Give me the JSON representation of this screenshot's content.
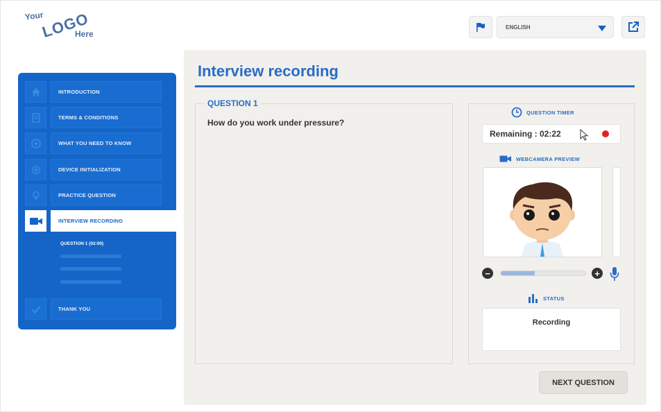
{
  "logo": {
    "line1": "Your",
    "line2": "LOGO",
    "line3": "Here"
  },
  "topbar": {
    "language": "ENGLISH",
    "icons": {
      "flag": "flag-icon",
      "popout": "external-link-icon",
      "caret": "chevron-down-icon"
    }
  },
  "sidebar": {
    "items": [
      {
        "label": "INTRODUCTION",
        "icon": "home-icon"
      },
      {
        "label": "TERMS & CONDITIONS",
        "icon": "document-icon"
      },
      {
        "label": "WHAT YOU NEED TO KNOW",
        "icon": "help-icon"
      },
      {
        "label": "DEVICE INITIALIZATION",
        "icon": "gear-icon"
      },
      {
        "label": "PRACTICE QUESTION",
        "icon": "lightbulb-icon"
      },
      {
        "label": "INTERVIEW RECORDING",
        "icon": "video-camera-icon"
      },
      {
        "label": "THANK YOU",
        "icon": "checkmark-icon"
      }
    ],
    "subitem": "QUESTION 1 (02:00)"
  },
  "main": {
    "title": "Interview recording",
    "question_label": "QUESTION 1",
    "question_text": "How do you work under pressure?",
    "timer_heading": "QUESTION TIMER",
    "timer_text": "Remaining : 02:22",
    "webcam_heading": "WEBCAMERA PREVIEW",
    "volume_level": 0.4,
    "status_heading": "STATUS",
    "status_text": "Recording",
    "next_button": "NEXT QUESTION"
  },
  "colors": {
    "accent": "#2a6cc6",
    "sidebar": "#1565c8",
    "record": "#e52020"
  }
}
